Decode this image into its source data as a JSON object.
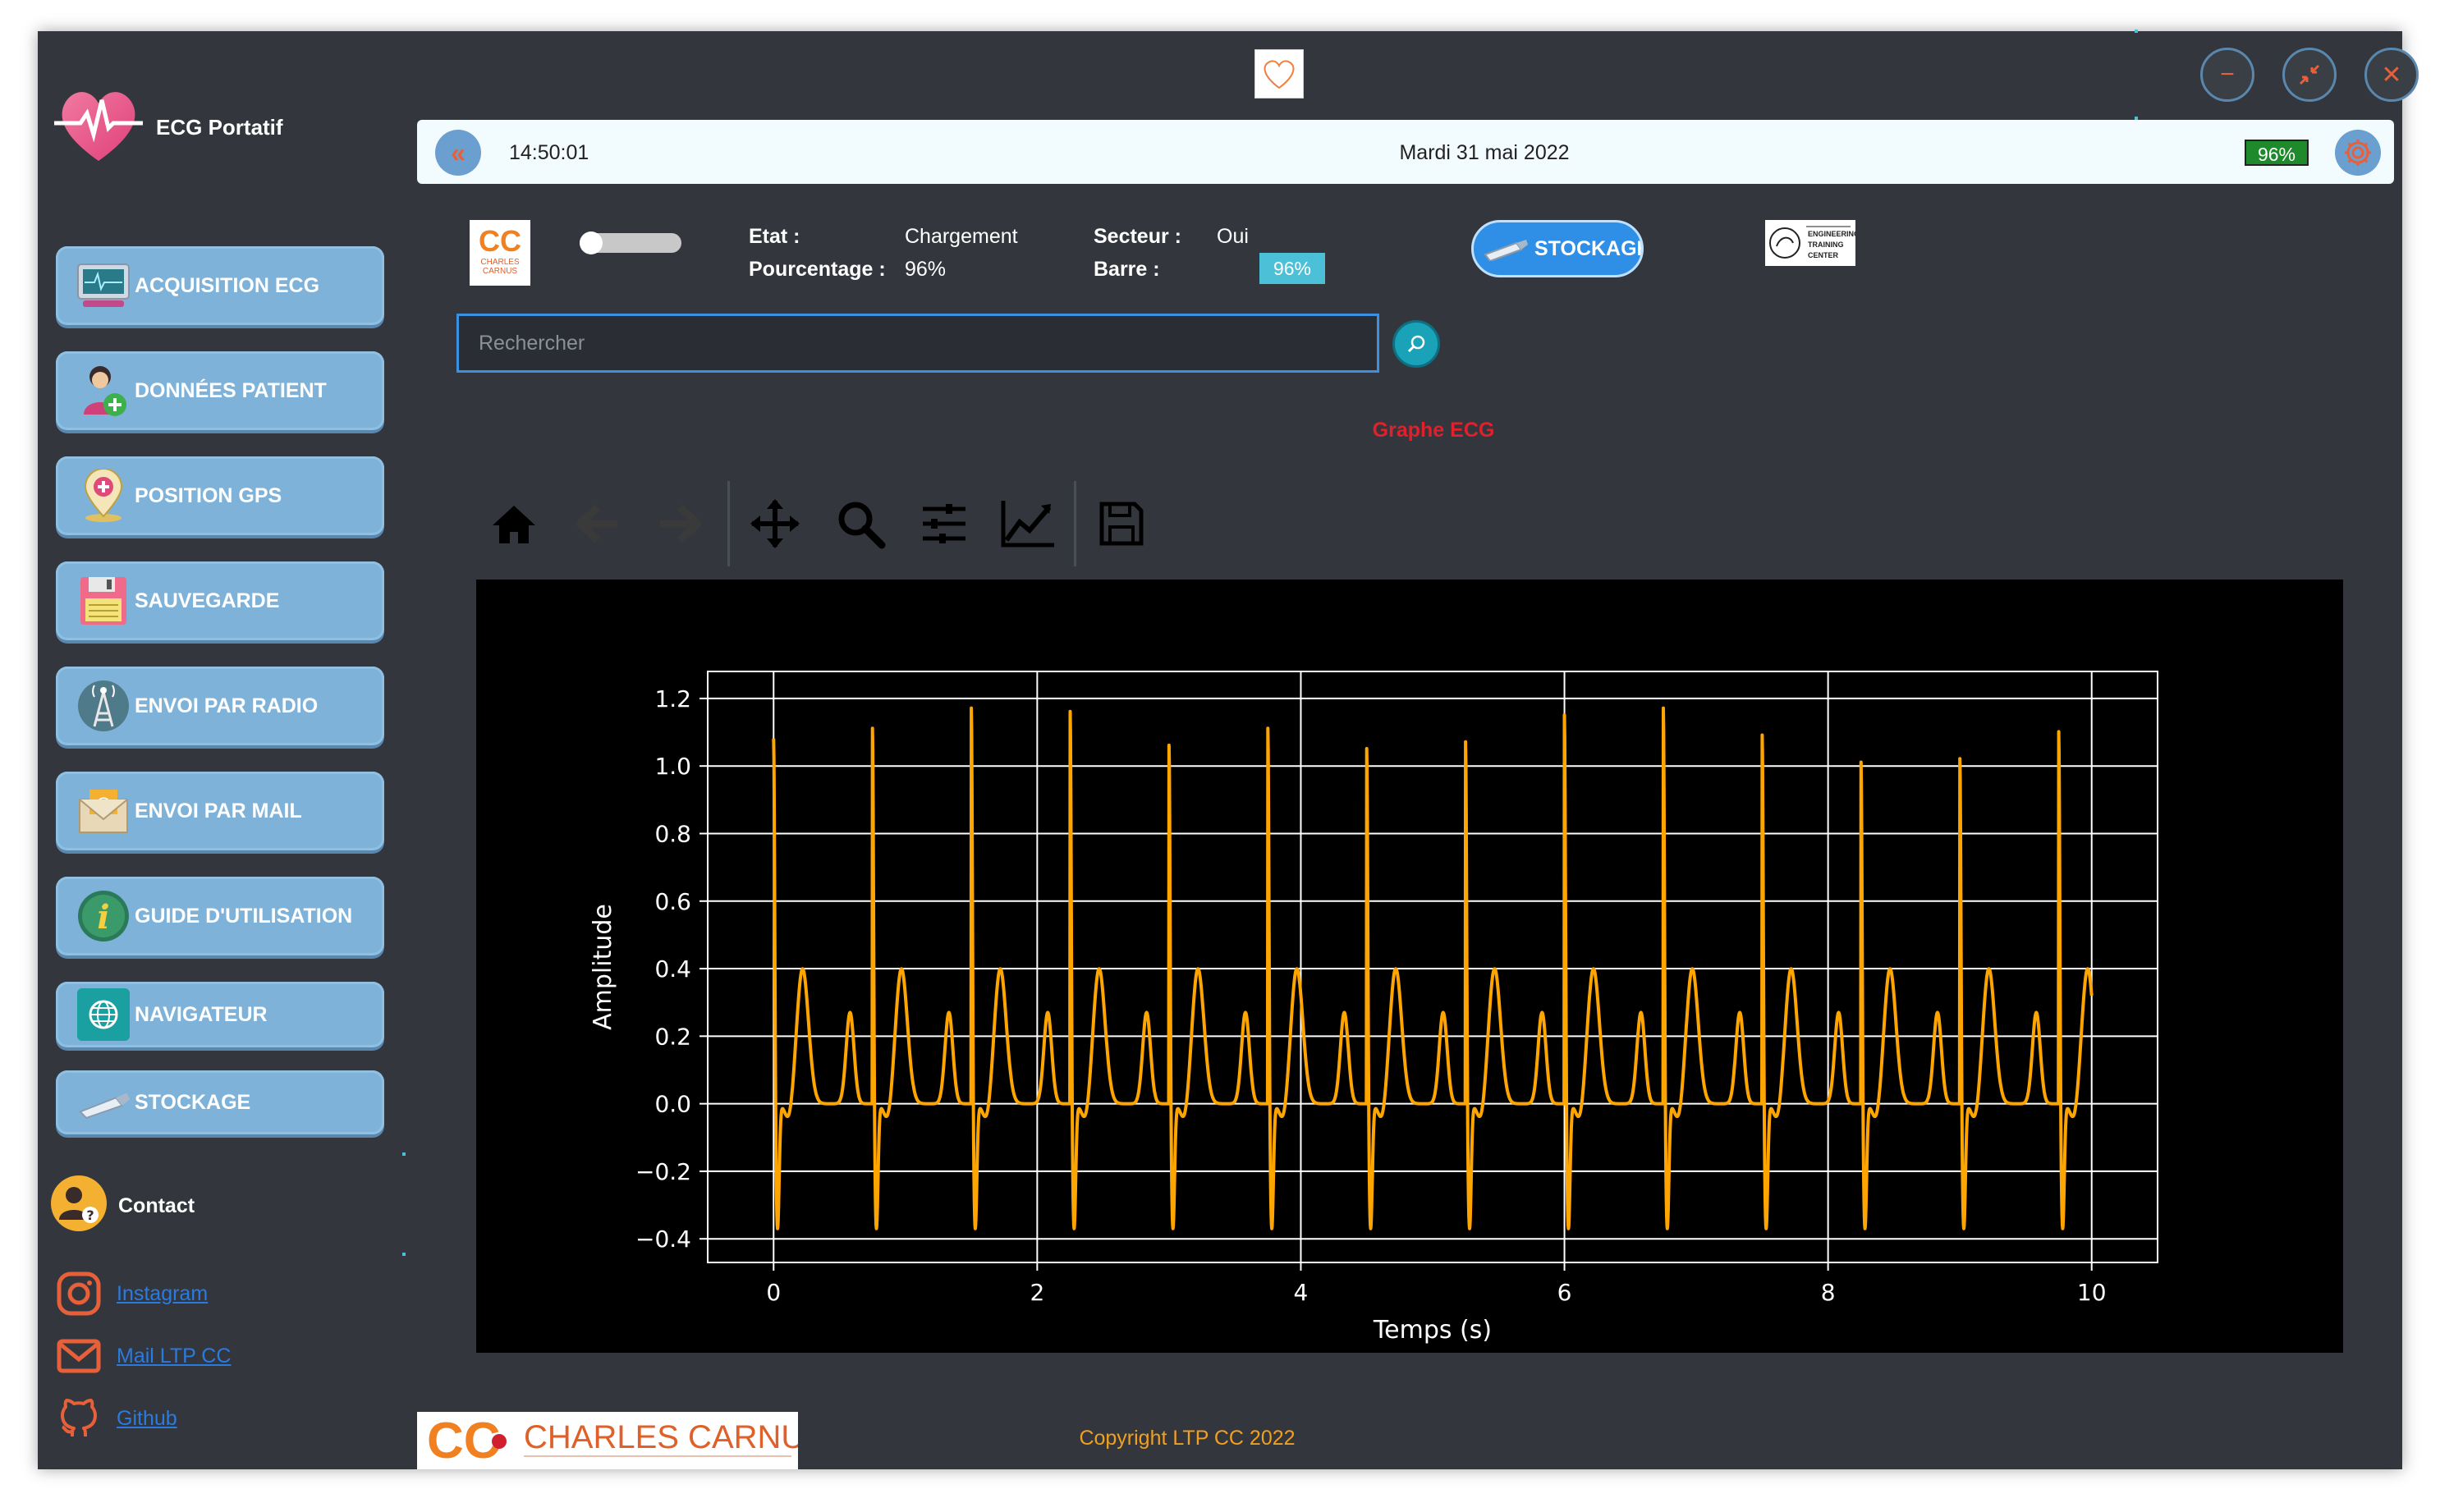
{
  "app": {
    "name": "ECG Portatif"
  },
  "sidebar": {
    "items": [
      {
        "label": "ACQUISITION ECG",
        "icon": "ecg-monitor-icon"
      },
      {
        "label": "DONNÉES PATIENT",
        "icon": "patient-add-icon"
      },
      {
        "label": "POSITION GPS",
        "icon": "gps-pin-icon"
      },
      {
        "label": "SAUVEGARDE",
        "icon": "floppy-disk-icon"
      },
      {
        "label": "ENVOI PAR RADIO",
        "icon": "radio-tower-icon"
      },
      {
        "label": "ENVOI PAR MAIL",
        "icon": "mail-envelope-icon"
      },
      {
        "label": "GUIDE D'UTILISATION",
        "icon": "info-icon"
      },
      {
        "label": "NAVIGATEUR",
        "icon": "globe-icon"
      },
      {
        "label": "STOCKAGE",
        "icon": "usb-drive-icon"
      }
    ],
    "contact": "Contact",
    "links": [
      "Instagram",
      "Mail LTP CC",
      "Github"
    ]
  },
  "topbar": {
    "time": "14:50:01",
    "date": "Mardi 31 mai 2022",
    "battery": "96%"
  },
  "status": {
    "etat_label": "Etat :",
    "etat_value": "Chargement",
    "pourcentage_label": "Pourcentage :",
    "pourcentage_value": "96%",
    "secteur_label": "Secteur :",
    "secteur_value": "Oui",
    "barre_label": "Barre :",
    "barre_value": "96%",
    "barre_fraction": 0.96,
    "stockage_button": "STOCKAGE"
  },
  "search": {
    "placeholder": "Rechercher"
  },
  "graph": {
    "title": "Graphe ECG"
  },
  "toolbar": {
    "icons": [
      "home-icon",
      "back-arrow-icon",
      "forward-arrow-icon",
      "pan-icon",
      "zoom-icon",
      "configure-subplots-icon",
      "edit-axis-icon",
      "save-icon"
    ]
  },
  "footer": {
    "copyright": "Copyright LTP CC 2022",
    "logo_text": "CHARLES CARNUS"
  },
  "colors": {
    "accent": "#7fb2d8",
    "window_bg": "#33373d",
    "ecg_line": "#ffa500",
    "graph_title": "#e0202a",
    "copyright": "#f0a020"
  },
  "chart_data": {
    "type": "line",
    "xlabel": "Temps (s)",
    "ylabel": "Amplitude",
    "xlim": [
      -0.5,
      10.5
    ],
    "ylim": [
      -0.47,
      1.28
    ],
    "xticks": [
      0,
      2,
      4,
      6,
      8,
      10
    ],
    "yticks": [
      -0.4,
      -0.2,
      0.0,
      0.2,
      0.4,
      0.6,
      0.8,
      1.0,
      1.2
    ],
    "ytick_labels": [
      "−0.4",
      "−0.2",
      "0.0",
      "0.2",
      "0.4",
      "0.6",
      "0.8",
      "1.0",
      "1.2"
    ],
    "grid": true,
    "beat_period_s": 0.75,
    "r_peaks": [
      1.1,
      1.13,
      1.19,
      1.18,
      1.08,
      1.13,
      1.07,
      1.09,
      1.17,
      1.19,
      1.11,
      1.03,
      1.04,
      1.12,
      1.18
    ],
    "t_wave_amp": 0.4,
    "p_wave_amp": 0.27,
    "s_min": -0.37,
    "series": [
      {
        "values_description": ""
      }
    ]
  }
}
